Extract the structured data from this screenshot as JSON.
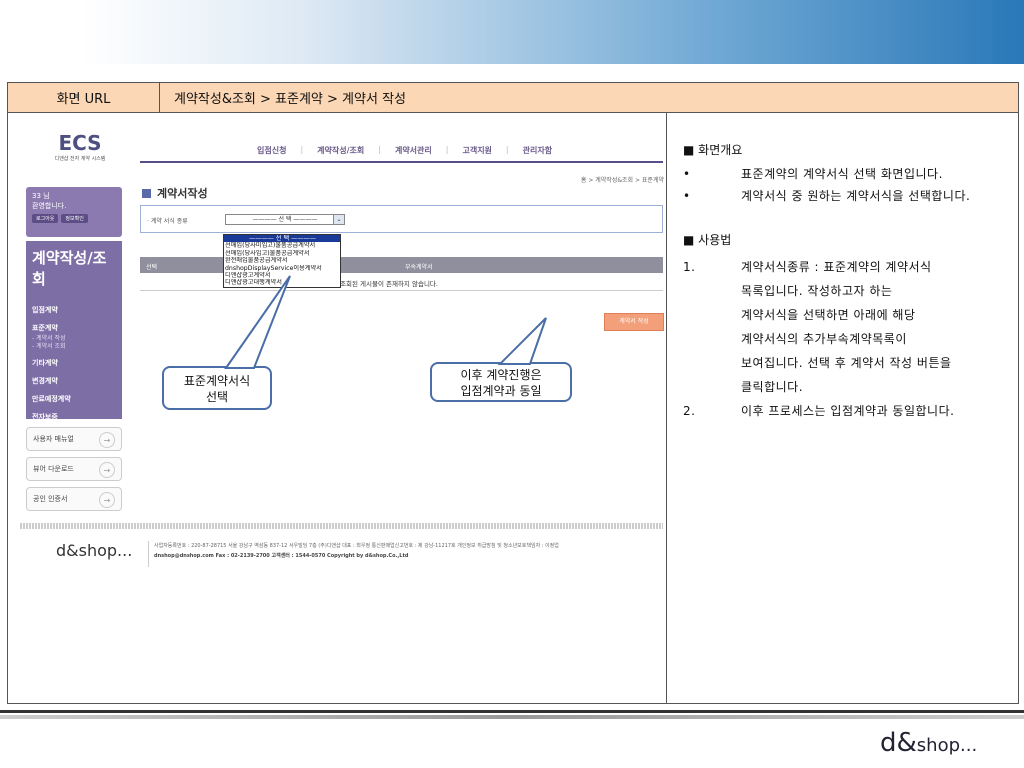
{
  "header": {
    "url_key": "화면 URL",
    "url_value": "계약작성&조회 > 표준계약 > 계약서 작성"
  },
  "description": {
    "overview_title": "■ 화면개요",
    "overview": [
      {
        "mark": "•",
        "text": "표준계약의 계약서식 선택 화면입니다."
      },
      {
        "mark": "•",
        "text": "계약서식 중 원하는 계약서식을 선택합니다."
      }
    ],
    "usage_title": "■ 사용법",
    "usage": [
      {
        "mark": "1.",
        "text": "계약서식종류 : 표준계약의 계약서식"
      },
      {
        "mark": "",
        "text": "목록입니다. 작성하고자 하는"
      },
      {
        "mark": "",
        "text": "계약서식을 선택하면 아래에 해당"
      },
      {
        "mark": "",
        "text": "계약서식의 추가부속계약목록이"
      },
      {
        "mark": "",
        "text": "보여집니다. 선택 후 계약서 작성 버튼을"
      },
      {
        "mark": "",
        "text": "클릭합니다."
      },
      {
        "mark": "2.",
        "text": "이후 프로세스는 입점계약과 동일합니다."
      }
    ]
  },
  "shot": {
    "logo": "ECS",
    "logo_sub": "디앤샵 전자 계약 시스템",
    "gnav": [
      "입점신청",
      "계약작성/조회",
      "계약서관리",
      "고객지원",
      "관리자함"
    ],
    "welcome_name": "33 님",
    "welcome_text": "환영합니다.",
    "logout": "로그아웃",
    "myinfo": "정보확인",
    "nav_title": "계약작성/조회",
    "nav_items": [
      "입점계약",
      "표준계약"
    ],
    "nav_sub": [
      "- 계약서 작성",
      "- 계약서 조회"
    ],
    "nav_items2": [
      "기타계약",
      "변경계약",
      "만료예정계약",
      "전자보증"
    ],
    "quick": [
      "사용자 매뉴얼",
      "뷰어 다운로드",
      "공인 인증서"
    ],
    "breadcrumb": "홈 > 계약작성&조회 > 표준계약",
    "page_title": "계약서작성",
    "form_label": "· 계약 서식 종류",
    "select_value": "———— 선 택 ————",
    "dropdown": [
      "———— 선 택 ————",
      "선매입(당사미입고)물품공급계약서",
      "선매입(당사입고)물품공급계약서",
      "완전매입물품공급계약서",
      "dnshopDisplayService이용계약서",
      "디앤샵광고계약서",
      "디앤샵광고대행계약서"
    ],
    "col_select": "선택",
    "col_attach": "부속계약서",
    "empty_msg": "조회된 게시물이 존재하지 않습니다.",
    "write_btn": "계약서 작성",
    "footer_logo": "d&shop...",
    "footer1": "사업자등록번호 : 220-87-28715  서울 강남구 역삼동 837-12 서우빌딩 7층 (주)디앤샵 대표 : 최우정 통신판매업신고번호 : 제 강남-11217호 개인정보 취급방침 및 청소년보호책임자 : 이정업",
    "footer2": "dnshop@dnshop.com Fax : 02-2139-2700 고객센터 : 1544-0570 Copyright by d&shop.Co.,Ltd"
  },
  "callouts": {
    "c1": [
      "표준계약서식",
      "선택"
    ],
    "c2": [
      "이후 계약진행은",
      "입점계약과 동일"
    ]
  },
  "brand": {
    "logo_main": "d&",
    "logo_tail": "shop..."
  }
}
